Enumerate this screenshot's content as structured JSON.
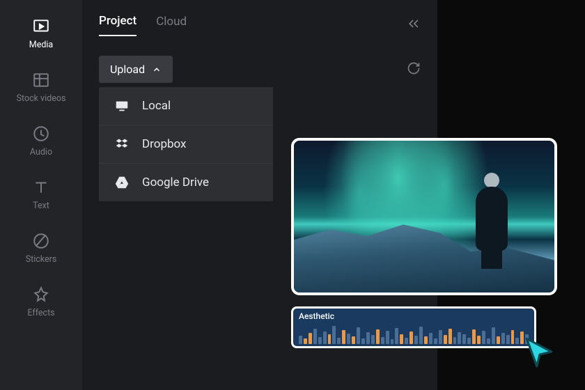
{
  "sidebar": {
    "items": [
      {
        "label": "Media"
      },
      {
        "label": "Stock videos"
      },
      {
        "label": "Audio"
      },
      {
        "label": "Text"
      },
      {
        "label": "Stickers"
      },
      {
        "label": "Effects"
      }
    ]
  },
  "tabs": {
    "project": "Project",
    "cloud": "Cloud"
  },
  "upload": {
    "button": "Upload",
    "options": [
      {
        "label": "Local"
      },
      {
        "label": "Dropbox"
      },
      {
        "label": "Google Drive"
      }
    ]
  },
  "audio": {
    "title": "Aesthetic"
  }
}
